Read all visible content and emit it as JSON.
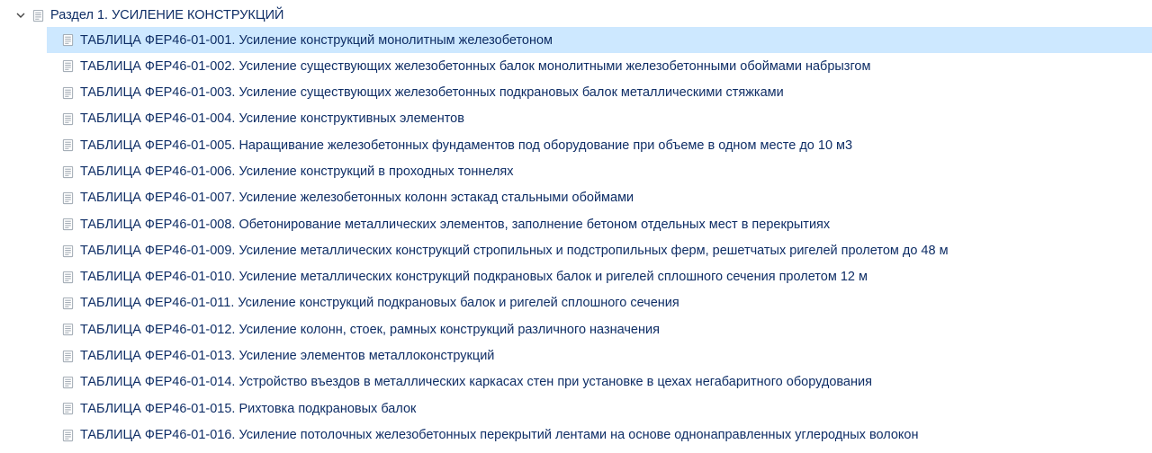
{
  "colors": {
    "selection_bg": "#cde8ff",
    "text": "#0f2e66"
  },
  "tree": {
    "section": {
      "label": "Раздел 1. УСИЛЕНИЕ КОНСТРУКЦИЙ",
      "expanded": true,
      "selected_index": 0,
      "items": [
        {
          "label": "ТАБЛИЦА ФЕР46-01-001. Усиление конструкций монолитным железобетоном"
        },
        {
          "label": "ТАБЛИЦА ФЕР46-01-002. Усиление существующих железобетонных балок монолитными железобетонными обоймами набрызгом"
        },
        {
          "label": "ТАБЛИЦА ФЕР46-01-003. Усиление существующих железобетонных подкрановых балок металлическими стяжками"
        },
        {
          "label": "ТАБЛИЦА ФЕР46-01-004. Усиление конструктивных элементов"
        },
        {
          "label": "ТАБЛИЦА ФЕР46-01-005. Наращивание железобетонных фундаментов под оборудование при объеме в одном месте до 10 м3"
        },
        {
          "label": "ТАБЛИЦА ФЕР46-01-006. Усиление конструкций в проходных тоннелях"
        },
        {
          "label": "ТАБЛИЦА ФЕР46-01-007. Усиление железобетонных колонн эстакад стальными обоймами"
        },
        {
          "label": "ТАБЛИЦА ФЕР46-01-008. Обетонирование металлических элементов, заполнение бетоном отдельных мест в перекрытиях"
        },
        {
          "label": "ТАБЛИЦА ФЕР46-01-009. Усиление металлических конструкций стропильных и подстропильных ферм, решетчатых ригелей пролетом до 48 м"
        },
        {
          "label": "ТАБЛИЦА ФЕР46-01-010. Усиление металлических конструкций подкрановых балок и ригелей сплошного сечения пролетом 12 м"
        },
        {
          "label": "ТАБЛИЦА ФЕР46-01-011. Усиление конструкций подкрановых балок и ригелей сплошного сечения"
        },
        {
          "label": "ТАБЛИЦА ФЕР46-01-012. Усиление колонн, стоек, рамных конструкций различного назначения"
        },
        {
          "label": "ТАБЛИЦА ФЕР46-01-013. Усиление элементов металлоконструкций"
        },
        {
          "label": "ТАБЛИЦА ФЕР46-01-014. Устройство въездов в металлических каркасах стен при установке в цехах негабаритного оборудования"
        },
        {
          "label": "ТАБЛИЦА ФЕР46-01-015. Рихтовка подкрановых балок"
        },
        {
          "label": "ТАБЛИЦА ФЕР46-01-016. Усиление потолочных железобетонных перекрытий лентами на основе однонаправленных углеродных волокон"
        }
      ]
    }
  }
}
